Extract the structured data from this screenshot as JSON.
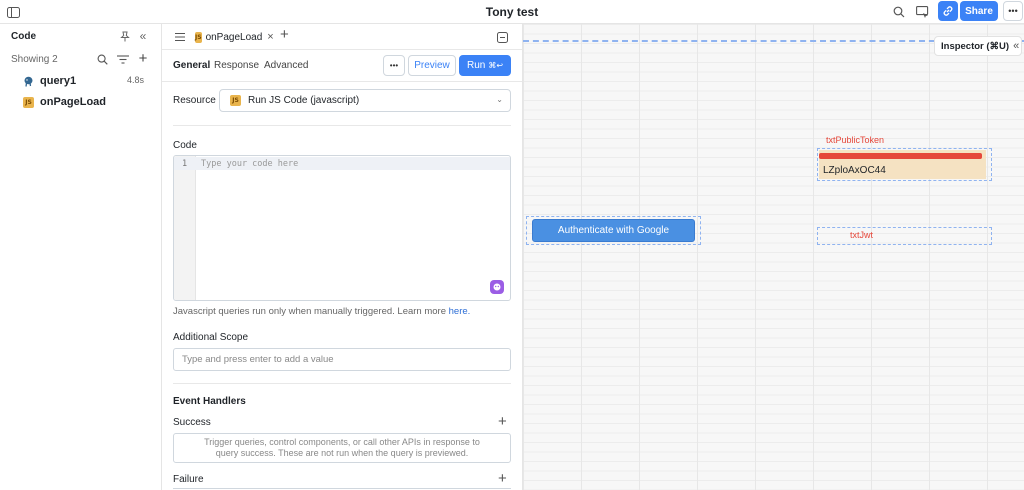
{
  "app": {
    "title": "Tony test"
  },
  "header": {
    "share_label": "Share"
  },
  "left_panel": {
    "title": "Code",
    "showing_label": "Showing 2",
    "items": [
      {
        "name": "query1",
        "duration": "4.8s",
        "icon": "postgres-icon"
      },
      {
        "name": "onPageLoad",
        "duration": "",
        "icon": "js-icon"
      }
    ]
  },
  "editor": {
    "active_tab": "onPageLoad",
    "tabs": [
      "General",
      "Response",
      "Advanced"
    ],
    "more_label": "•••",
    "preview_label": "Preview",
    "run_label": "Run",
    "run_shortcut": "⌘↩",
    "resource_label": "Resource",
    "resource_value": "Run JS Code (javascript)",
    "code_label": "Code",
    "code_line_number": "1",
    "code_placeholder": "Type your code here",
    "help_text": "Javascript queries run only when manually triggered. Learn more",
    "help_link": "here.",
    "scope_label": "Additional Scope",
    "scope_placeholder": "Type and press enter to add a value",
    "event_handlers_label": "Event Handlers",
    "success_label": "Success",
    "success_text": "Trigger queries, control components, or call other APIs in response to query success. These are not run when the query is previewed.",
    "failure_label": "Failure"
  },
  "canvas": {
    "inspector_label": "Inspector (⌘U)",
    "auth_button_label": "Authenticate with Google",
    "public_token_label": "txtPublicToken",
    "public_token_value": "LZploAxOC44",
    "jwt_label": "txtJwt"
  },
  "colors": {
    "accent": "#3b82f6",
    "canvas_label": "#e5473a",
    "js_badge": "#e9b44c"
  }
}
